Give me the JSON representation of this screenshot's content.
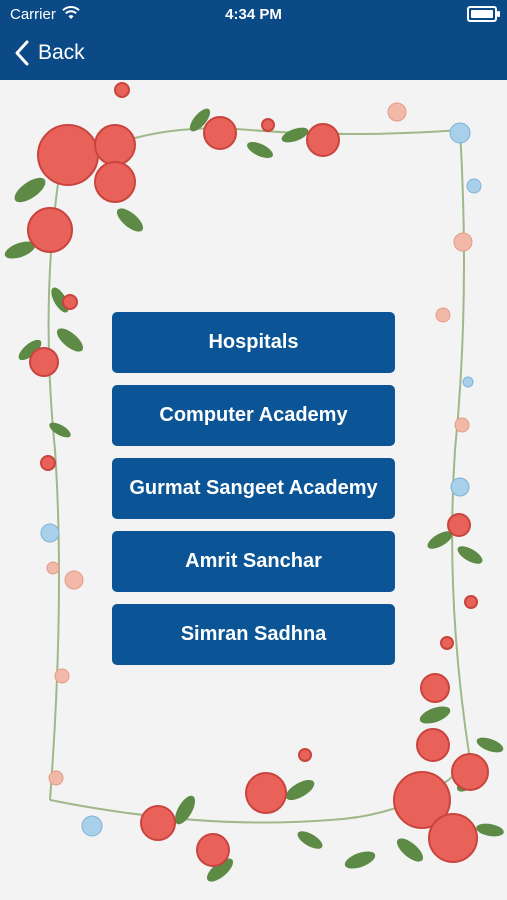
{
  "status_bar": {
    "carrier": "Carrier",
    "time": "4:34 PM"
  },
  "nav": {
    "back_label": "Back"
  },
  "menu": {
    "items": [
      "Hospitals",
      "Computer Academy",
      "Gurmat Sangeet Academy",
      "Amrit Sanchar",
      "Simran Sadhna"
    ]
  },
  "colors": {
    "header": "#0b4a86",
    "button": "#0b5596",
    "background": "#f3f3f3",
    "rose": "#e8625a",
    "leaf": "#5d8a45"
  }
}
